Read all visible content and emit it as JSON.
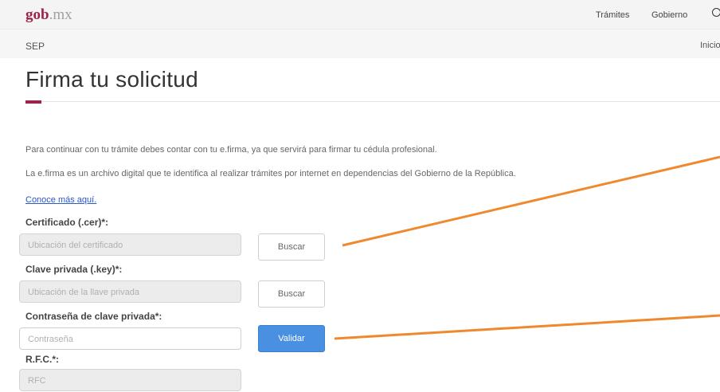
{
  "header": {
    "logo_gob": "gob",
    "logo_mx": ".mx",
    "nav": [
      "Trámites",
      "Gobierno"
    ]
  },
  "subheader": {
    "left": "SEP",
    "right": "Inicio"
  },
  "page": {
    "title": "Firma tu solicitud",
    "para1": "Para continuar con tu trámite debes contar con tu e.firma, ya que servirá para firmar tu cédula profesional.",
    "para2": "La e.firma es un archivo digital que te identifica al realizar trámites por internet en dependencias del Gobierno de la República.",
    "link": "Conoce más aquí."
  },
  "form": {
    "cer_label": "Certificado (.cer)*:",
    "cer_placeholder": "Ubicación del certificado",
    "key_label": "Clave privada (.key)*:",
    "key_placeholder": "Ubicación de la llave privada",
    "pass_label": "Contraseña de clave privada*:",
    "pass_placeholder": "Contraseña",
    "rfc_label": "R.F.C.*:",
    "rfc_placeholder": "RFC",
    "browse_label": "Buscar",
    "validate_label": "Validar"
  },
  "colors": {
    "brand": "#9d2449",
    "primary": "#4a90e2",
    "annotation": "#f0882d",
    "link": "#2a57c9"
  }
}
